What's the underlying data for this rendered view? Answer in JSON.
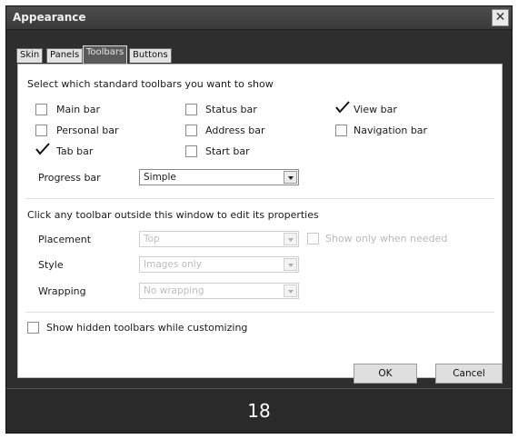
{
  "window": {
    "title": "Appearance"
  },
  "tabs": [
    {
      "label": "Skin"
    },
    {
      "label": "Panels"
    },
    {
      "label": "Toolbars"
    },
    {
      "label": "Buttons"
    }
  ],
  "panel": {
    "section1_text": "Select which standard toolbars you want to show",
    "toolbars": [
      {
        "label": "Main bar",
        "checked": false
      },
      {
        "label": "Status bar",
        "checked": false
      },
      {
        "label": "View bar",
        "checked": true
      },
      {
        "label": "Personal bar",
        "checked": false
      },
      {
        "label": "Address bar",
        "checked": false
      },
      {
        "label": "Navigation bar",
        "checked": false
      },
      {
        "label": "Tab bar",
        "checked": true
      },
      {
        "label": "Start bar",
        "checked": false
      }
    ],
    "progress": {
      "label": "Progress bar",
      "value": "Simple"
    },
    "section2_text": "Click any toolbar outside this window to edit its properties",
    "placement": {
      "label": "Placement",
      "value": "Top"
    },
    "show_only_when_needed": {
      "label": "Show only when needed",
      "checked": false
    },
    "style": {
      "label": "Style",
      "value": "Images only"
    },
    "wrapping": {
      "label": "Wrapping",
      "value": "No wrapping"
    },
    "show_hidden": {
      "label": "Show hidden toolbars while customizing",
      "checked": false
    }
  },
  "buttons": {
    "ok": "OK",
    "cancel": "Cancel"
  },
  "page_number": "18"
}
